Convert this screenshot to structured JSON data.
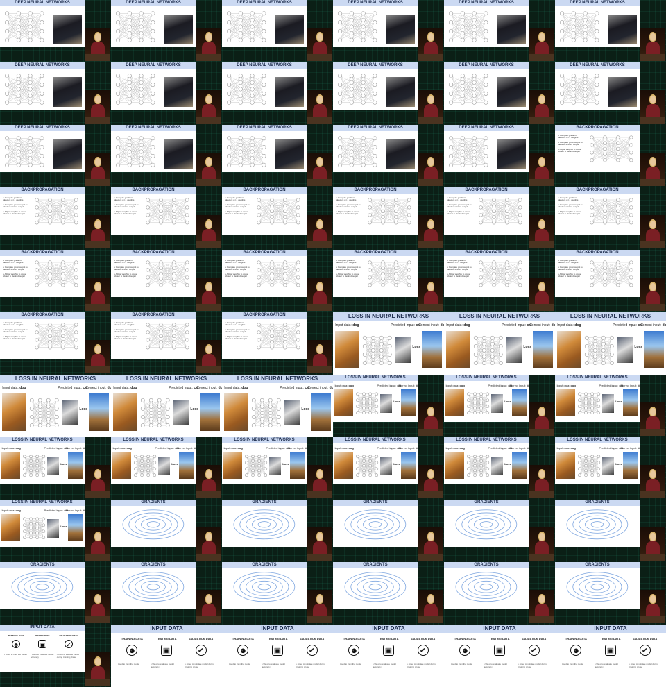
{
  "slide_titles": {
    "dnn": "DEEP NEURAL NETWORKS",
    "bp": "BACKPROPAGATION",
    "loss": "LOSS IN NEURAL NETWORKS",
    "grad": "GRADIENTS",
    "input": "INPUT DATA"
  },
  "loss_labels": {
    "input_label": "Input data:",
    "input_value": "dog",
    "predicted_label": "Predicted input:",
    "predicted_value": "cat",
    "correct_label": "Correct input:",
    "correct_value": "dog",
    "loss_word": "Loss"
  },
  "backprop_bullets": [
    "Compute gradient descent w.r.t. weights",
    "Compare given output to desired system output",
    "Adjust weights to come closer to desired output"
  ],
  "input_columns": [
    {
      "heading": "TRAINING DATA",
      "icon": "brain-person-icon",
      "desc": "Used to train the model"
    },
    {
      "heading": "TESTING DATA",
      "icon": "presenter-icon",
      "desc": "Used to evaluate model accuracy"
    },
    {
      "heading": "VALIDATION DATA",
      "icon": "checkmark-icon",
      "desc": "Used to validate model during training phase"
    }
  ],
  "colors": {
    "title_bar": "#cbd9f2",
    "background": "#0b1f16",
    "accent_green": "#2fd7a7",
    "gradient_line": "#7fa7e0"
  },
  "frames": [
    "dnn",
    "dnn",
    "dnn",
    "dnn",
    "dnn",
    "dnn",
    "dnn",
    "dnn",
    "dnn",
    "dnn",
    "dnn",
    "dnn",
    "dnn",
    "dnn",
    "dnn",
    "dnn",
    "dnn",
    "bp",
    "bp",
    "bp",
    "bp",
    "bp",
    "bp",
    "bp",
    "bp",
    "bp",
    "bp",
    "bp",
    "bp",
    "bp",
    "bp",
    "bp",
    "bp",
    "loss-full",
    "loss-full",
    "loss-full",
    "loss-full",
    "loss-full",
    "loss-full",
    "loss",
    "loss",
    "loss",
    "loss",
    "loss",
    "loss",
    "loss",
    "loss",
    "loss",
    "loss",
    "grad",
    "grad",
    "grad",
    "grad",
    "grad",
    "grad",
    "grad",
    "grad",
    "grad",
    "grad",
    "grad",
    "input",
    "input-full",
    "input-full",
    "input-full",
    "input-full",
    "input-full"
  ]
}
